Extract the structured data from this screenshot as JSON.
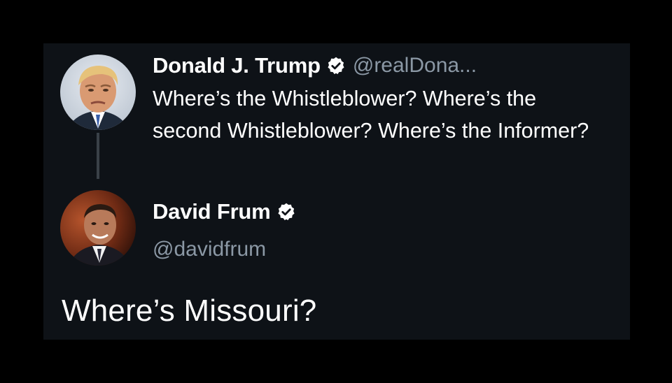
{
  "parent_tweet": {
    "display_name": "Donald J. Trump",
    "verified": true,
    "handle": "@realDona...",
    "text": "Where’s the Whistleblower? Where’s the second Whistleblower? Where’s the Informer?",
    "avatar_icon": "profile-photo"
  },
  "reply_tweet": {
    "display_name": "David Frum",
    "verified": true,
    "handle": "@davidfrum",
    "text": "Where’s Missouri?",
    "avatar_icon": "profile-photo"
  },
  "colors": {
    "background": "#0e1217",
    "primary_text": "#ffffff",
    "secondary_text": "#8b98a5",
    "thread_line": "#3a4148"
  }
}
